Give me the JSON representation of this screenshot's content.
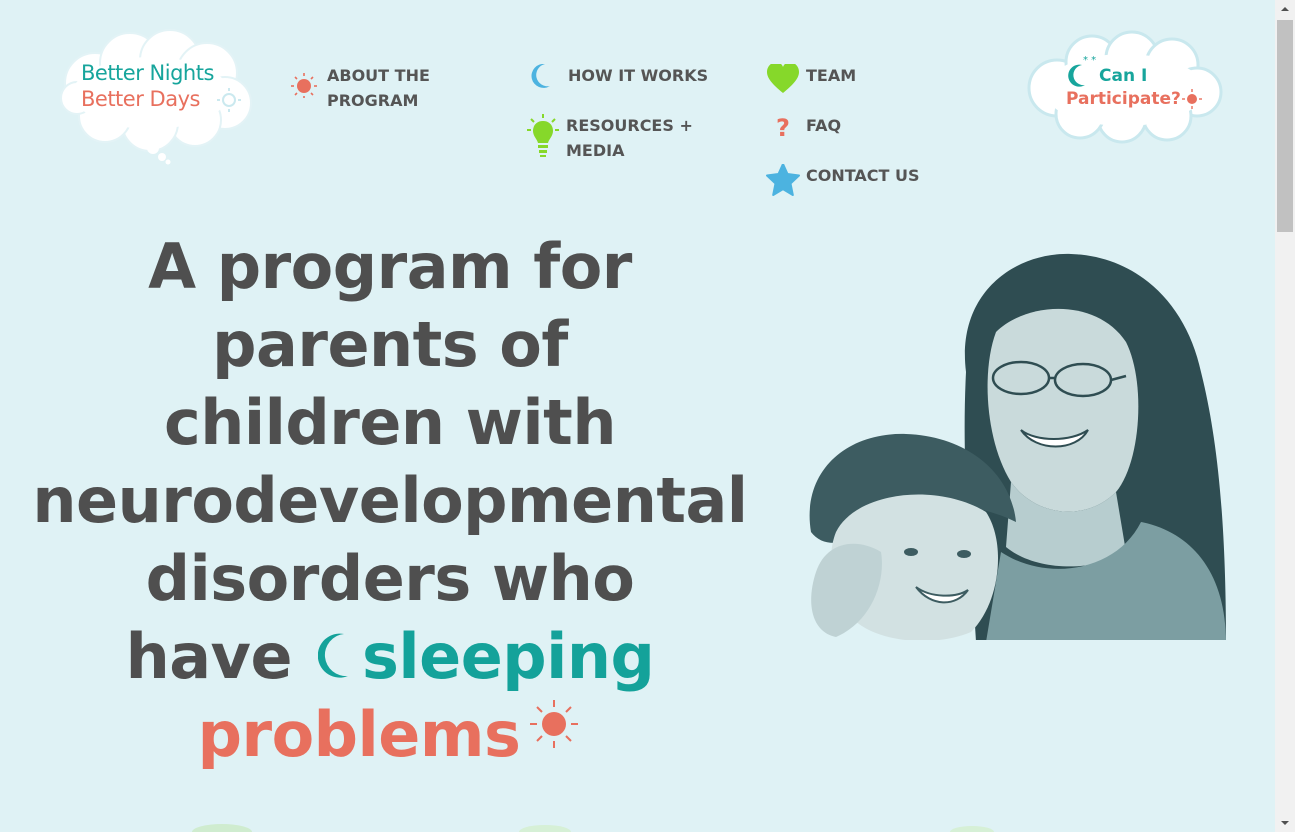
{
  "logo": {
    "line1": "Better Nights",
    "line2": "Better Days"
  },
  "nav": {
    "about": {
      "label": "ABOUT THE PROGRAM",
      "icon": "sun-icon"
    },
    "how": {
      "label": "HOW IT WORKS",
      "icon": "moon-icon"
    },
    "resources": {
      "label": "RESOURCES + MEDIA",
      "icon": "lightbulb-icon"
    },
    "team": {
      "label": "TEAM",
      "icon": "heart-icon"
    },
    "faq": {
      "label": "FAQ",
      "icon": "question-icon"
    },
    "contact": {
      "label": "CONTACT US",
      "icon": "star-icon"
    }
  },
  "cta": {
    "line1": "Can I",
    "line2": "Participate?"
  },
  "headline": {
    "line1": "A program for",
    "line2": "parents of",
    "line3": "children with",
    "line4": "neurodevelopmental",
    "line5": "disorders who",
    "have": "have",
    "sleeping": "sleeping",
    "problems": "problems"
  },
  "colors": {
    "background": "#dff2f5",
    "teal": "#14a29a",
    "coral": "#e8705e",
    "text": "#4f4f4f",
    "green": "#86d82a",
    "blue": "#4cb3e0"
  }
}
